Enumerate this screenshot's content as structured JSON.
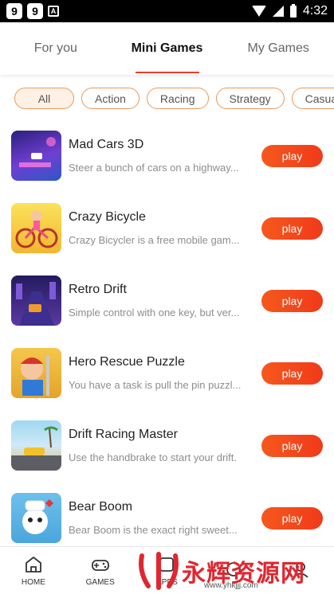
{
  "statusbar": {
    "notif1": "9",
    "notif2": "9",
    "notif3": "A",
    "time": "4:32"
  },
  "tabs": [
    {
      "label": "For you",
      "active": false
    },
    {
      "label": "Mini Games",
      "active": true
    },
    {
      "label": "My Games",
      "active": false
    }
  ],
  "chips": [
    {
      "label": "All",
      "active": true
    },
    {
      "label": "Action",
      "active": false
    },
    {
      "label": "Racing",
      "active": false
    },
    {
      "label": "Strategy",
      "active": false
    },
    {
      "label": "Casual",
      "active": false
    }
  ],
  "games": [
    {
      "name": "Mad Cars 3D",
      "desc": "Steer a bunch of cars on a highway...",
      "play": "play",
      "thumb_colors": [
        "#3a2a8c",
        "#9b44d8"
      ]
    },
    {
      "name": "Crazy Bicycle",
      "desc": "Crazy Bicycler is a free mobile gam...",
      "play": "play",
      "thumb_colors": [
        "#f7d13c",
        "#f2a92a"
      ]
    },
    {
      "name": "Retro Drift",
      "desc": "Simple control with one key, but ver...",
      "play": "play",
      "thumb_colors": [
        "#2a1f6e",
        "#6b3fb0"
      ]
    },
    {
      "name": "Hero Rescue Puzzle",
      "desc": "You have a task is pull the pin puzzl...",
      "play": "play",
      "thumb_colors": [
        "#f0b33a",
        "#d8342b"
      ]
    },
    {
      "name": "Drift Racing Master",
      "desc": "Use the handbrake to start your drift.",
      "play": "play",
      "thumb_colors": [
        "#8fd1ef",
        "#e9c16b"
      ]
    },
    {
      "name": "Bear Boom",
      "desc": "Bear Boom is the exact right sweet...",
      "play": "play",
      "thumb_colors": [
        "#69bde8",
        "#ffffff"
      ]
    }
  ],
  "bottomnav": [
    {
      "label": "HOME",
      "icon": "home-icon"
    },
    {
      "label": "GAMES",
      "icon": "gamepad-icon"
    },
    {
      "label": "APPS",
      "icon": "apps-icon"
    },
    {
      "label": "",
      "icon": "more-icon"
    },
    {
      "label": "",
      "icon": "profile-icon"
    }
  ],
  "watermark": {
    "text": "永辉资源网",
    "url": "www.yhkjjj.com"
  },
  "colors": {
    "accent": "#ef3b2c",
    "play_button": "#f24a1b",
    "chip_border": "#e79a5f"
  }
}
